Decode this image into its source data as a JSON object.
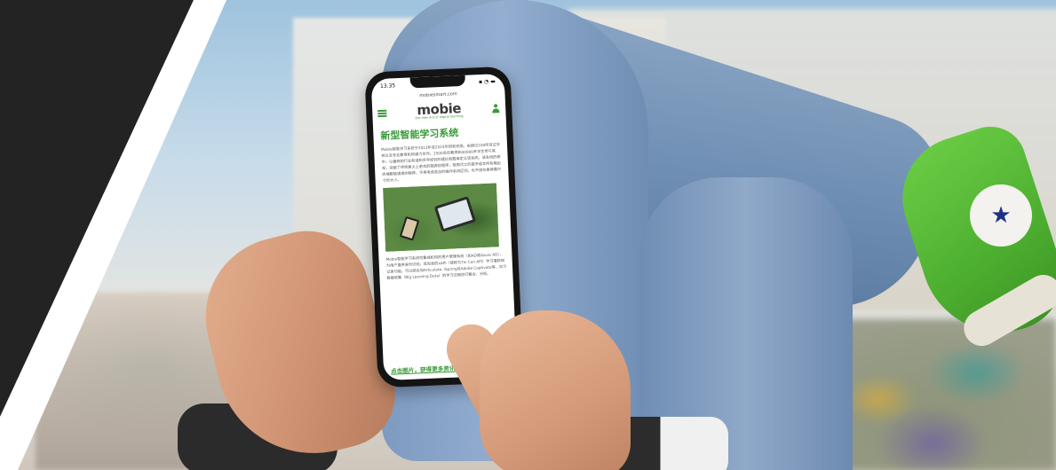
{
  "phone": {
    "status_time": "13.35",
    "url": "mobiesmart.com",
    "logo_word": "mobie",
    "logo_tagline": "the new era of digital learning",
    "headline": "新型智能学习系统",
    "paragraph_1": "Mobie智能学习系统于2013年至2015年研发完成。由超过100所百兰学校以及专业教育机构通力合作。2500名任教师和40000多学生参与其中。以最高的行业标准和多年经验的理论和题库定义该系统。该系统的研发，突破了传统意义上老式的题源目程序，取而代之的是多语言所有输出终端都能通用的程序，不用考虑各自的操作系统区别，也不用在意屏幕尺寸的大小。",
    "paragraph_2": "Mobie智能学习系统可集成机构的用户管理系统（如AD或Azure AD），为用户提供身份识别；其包含的xAPI（或称为Tin Can API）学习遭踪和记录功能，可以结合如Articulate, iSpring及Adobe Captivate等…学习数据收集（Big Learning Data）的学习过程进行整合、分析。",
    "link_text": "点击图片，获得更多资讯"
  },
  "colors": {
    "brand_green": "#3a9a39",
    "dark_panel": "#232323"
  }
}
